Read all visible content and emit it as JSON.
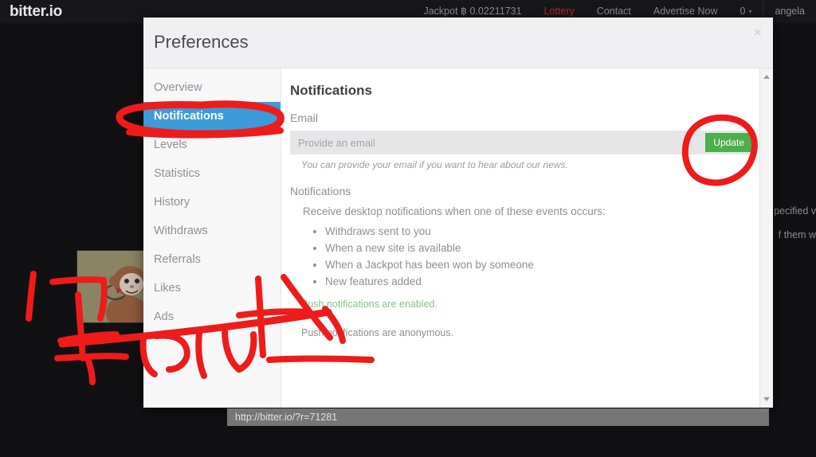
{
  "site": {
    "brand": "bitter.io",
    "nav": [
      {
        "label": "Jackpot ฿ 0.02211731",
        "kind": "jackpot"
      },
      {
        "label": "Lottery",
        "kind": "lottery"
      },
      {
        "label": "Contact",
        "kind": "link"
      },
      {
        "label": "Advertise Now",
        "kind": "link"
      },
      {
        "label": "0",
        "kind": "counter"
      },
      {
        "label": "angela",
        "kind": "user"
      }
    ],
    "background_text": [
      "pecified v",
      "f them w"
    ]
  },
  "modal": {
    "title": "Preferences",
    "close_icon": "close-icon",
    "sidebar": {
      "items": [
        {
          "label": "Overview",
          "active": false
        },
        {
          "label": "Notifications",
          "active": true
        },
        {
          "label": "Levels",
          "active": false
        },
        {
          "label": "Statistics",
          "active": false
        },
        {
          "label": "History",
          "active": false
        },
        {
          "label": "Withdraws",
          "active": false
        },
        {
          "label": "Referrals",
          "active": false
        },
        {
          "label": "Likes",
          "active": false
        },
        {
          "label": "Ads",
          "active": false
        }
      ]
    },
    "content": {
      "heading": "Notifications",
      "email_label": "Email",
      "email_value": "",
      "email_placeholder": "Provide an email",
      "update_button": "Update",
      "email_help": "You can provide your email if you want to hear about our news.",
      "notifications_label": "Notifications",
      "notifications_desc": "Receive desktop notifications when one of these events occurs:",
      "events": [
        "Withdraws sent to you",
        "When a new site is available",
        "When a Jackpot has been won by someone",
        "New features added"
      ],
      "enabled_status": "Push notifications are enabled.",
      "anonymous_note": "Push notifications are anonymous."
    }
  },
  "statusbar": {
    "url": "http://bitter.io/?r=71281"
  },
  "colors": {
    "accent_blue": "#3d9bd9",
    "button_green": "#4cae4c",
    "status_green": "#85c285",
    "lottery_red": "#b02a31",
    "marker_red": "#ee1b1b"
  }
}
